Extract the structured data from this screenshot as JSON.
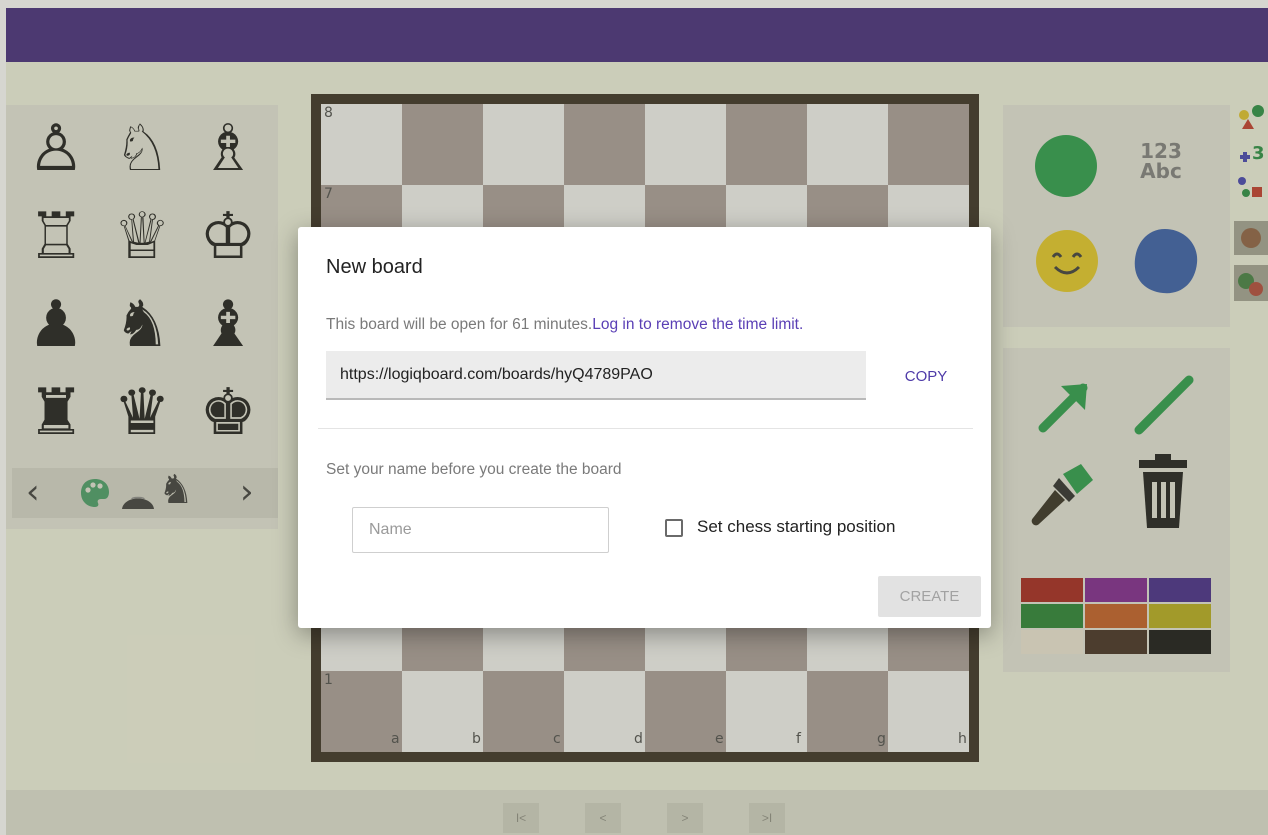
{
  "colors": {
    "topbar": "#3a1f78",
    "app_bg": "#f0f2de",
    "board_light": "#f4f4f2",
    "board_dark": "#a69a96",
    "link": "#5a3fb5",
    "accent": "#4e3aa8"
  },
  "palette_left": {
    "pieces": [
      {
        "name": "white-pawn-icon",
        "glyph": "♙"
      },
      {
        "name": "white-knight-icon",
        "glyph": "♘"
      },
      {
        "name": "white-bishop-icon",
        "glyph": "♗"
      },
      {
        "name": "white-rook-icon",
        "glyph": "♖"
      },
      {
        "name": "white-queen-icon",
        "glyph": "♕"
      },
      {
        "name": "white-king-icon",
        "glyph": "♔"
      },
      {
        "name": "black-pawn-icon",
        "glyph": "♟"
      },
      {
        "name": "black-knight-icon",
        "glyph": "♞"
      },
      {
        "name": "black-bishop-icon",
        "glyph": "♝"
      },
      {
        "name": "black-rook-icon",
        "glyph": "♜"
      },
      {
        "name": "black-queen-icon",
        "glyph": "♛"
      },
      {
        "name": "black-king-icon",
        "glyph": "♚"
      }
    ],
    "carousel": {
      "prev": "‹",
      "next": "›",
      "icons": [
        "palette-icon",
        "dome-icon",
        "knight-set-icon"
      ]
    }
  },
  "board": {
    "ranks": [
      "8",
      "7",
      "1"
    ],
    "files": [
      "a",
      "b",
      "c",
      "d",
      "e",
      "f",
      "g",
      "h"
    ]
  },
  "palette_right": {
    "text_tool": {
      "line1": "123",
      "line2": "Abc"
    },
    "icons": [
      "green-circle-icon",
      "text-tool-icon",
      "smiley-icon",
      "blue-blob-icon",
      "arrow-icon",
      "line-icon",
      "brush-icon",
      "trash-icon"
    ],
    "swatches": [
      "#a21a12",
      "#7a1a8c",
      "#3b1f86",
      "#1e7d2a",
      "#c2571a",
      "#b5aa12",
      "#ece6d4",
      "#3a2418",
      "#0a0a0a"
    ]
  },
  "bottom_nav": [
    "I<",
    "<",
    ">",
    ">I"
  ],
  "dialog": {
    "title": "New board",
    "info_text": "This board will be open for 61 minutes.",
    "info_link": "Log in to remove the time limit.",
    "url": "https://logiqboard.com/boards/hyQ4789PAO",
    "copy_label": "COPY",
    "name_hint": "Set your name before you create the board",
    "name_placeholder": "Name",
    "name_value": "",
    "checkbox_label": "Set chess starting position",
    "checkbox_checked": false,
    "create_label": "CREATE"
  }
}
